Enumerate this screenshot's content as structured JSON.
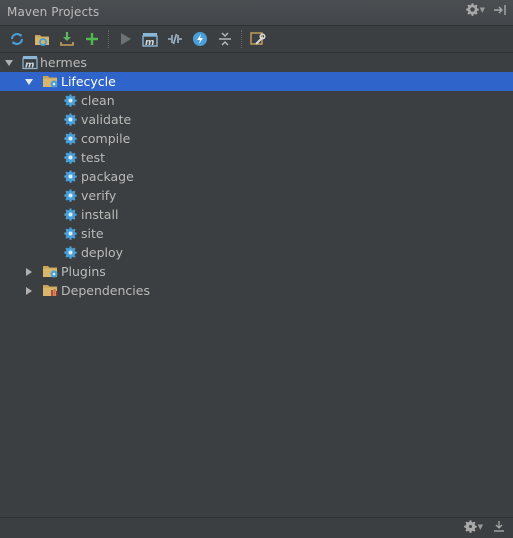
{
  "window": {
    "title": "Maven Projects"
  },
  "toolbar": {
    "buttons": [
      {
        "name": "reimport-icon",
        "tooltip": "Reimport All Maven Projects"
      },
      {
        "name": "generate-sources-icon",
        "tooltip": "Generate Sources"
      },
      {
        "name": "download-icon",
        "tooltip": "Download Sources and Documentation"
      },
      {
        "name": "add-icon",
        "tooltip": "Add Maven Projects"
      },
      {
        "name": "run-icon",
        "tooltip": "Run Maven Build"
      },
      {
        "name": "execute-goal-icon",
        "tooltip": "Execute Maven Goal"
      },
      {
        "name": "toggle-offline-icon",
        "tooltip": "Toggle Offline Mode"
      },
      {
        "name": "skip-tests-icon",
        "tooltip": "Toggle Skip Tests Mode"
      },
      {
        "name": "collapse-all-icon",
        "tooltip": "Collapse All"
      },
      {
        "name": "settings-wrench-icon",
        "tooltip": "Maven Settings"
      }
    ]
  },
  "tree": {
    "project": "hermes",
    "lifecycle": {
      "label": "Lifecycle",
      "goals": [
        "clean",
        "validate",
        "compile",
        "test",
        "package",
        "verify",
        "install",
        "site",
        "deploy"
      ]
    },
    "plugins": {
      "label": "Plugins"
    },
    "dependencies": {
      "label": "Dependencies"
    }
  },
  "colors": {
    "panel_bg": "#3c3f41",
    "selection": "#2f65ca",
    "text": "#bbbbbb",
    "gear_blue": "#4a9fd8",
    "folder": "#c8a25a"
  }
}
